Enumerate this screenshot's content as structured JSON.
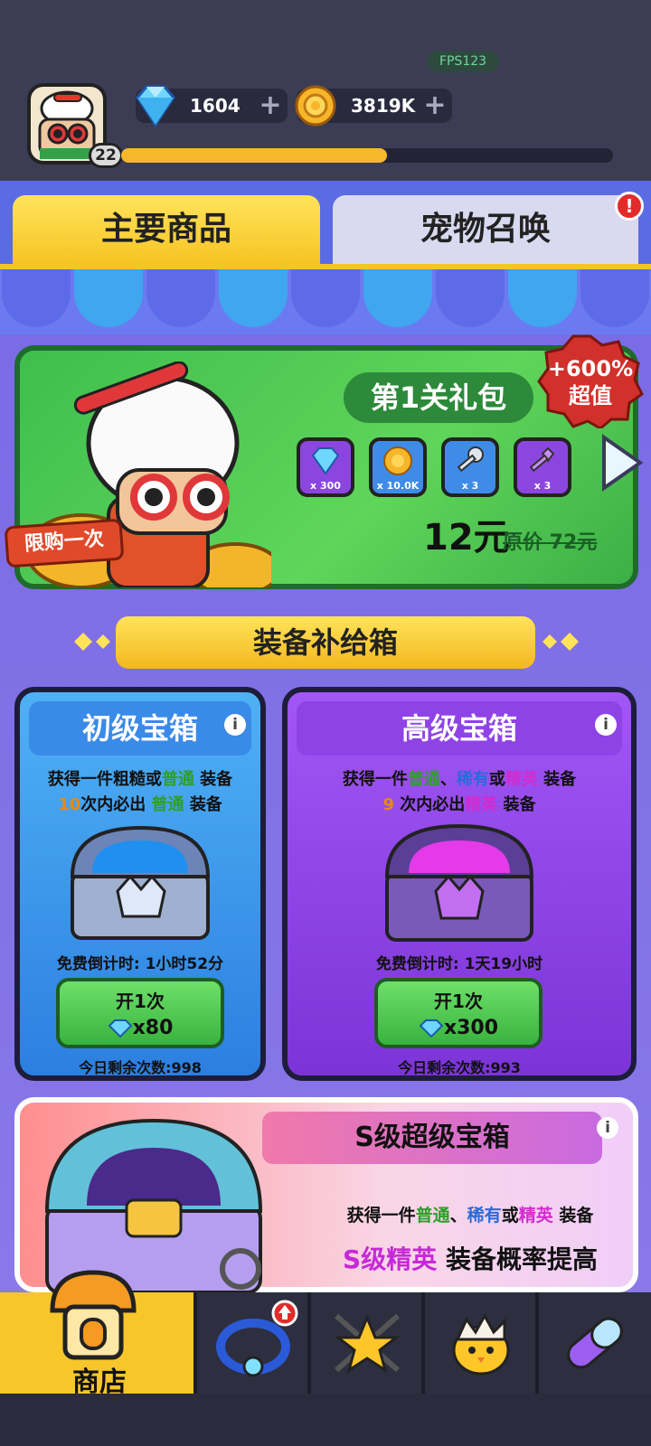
{
  "hud": {
    "fps": "FPS123",
    "level": "22",
    "gems": "1604",
    "gold": "3819K",
    "xp_progress": 0.54
  },
  "tabs": [
    {
      "label": "主要商品",
      "active": true
    },
    {
      "label": "宠物召唤",
      "active": false,
      "alert": "!"
    }
  ],
  "gift_pack": {
    "title": "第1关礼包",
    "limited": "限购一次",
    "badge_line1": "+600%",
    "badge_line2": "超值",
    "items": [
      {
        "icon": "gem-icon",
        "qty": "x 300"
      },
      {
        "icon": "gold-coin-icon",
        "qty": "x 10.0K"
      },
      {
        "icon": "silver-key-icon",
        "qty": "x 3"
      },
      {
        "icon": "purple-key-icon",
        "qty": "x 3"
      }
    ],
    "price": "12元",
    "original_price": "原价 72元"
  },
  "section_title": "装备补给箱",
  "chests": {
    "basic": {
      "title": "初级宝箱",
      "desc1_a": "获得一件粗糙或",
      "desc1_b": "普通",
      "desc1_c": "装备",
      "desc2_a": "10",
      "desc2_b": "次内必出",
      "desc2_c": "普通",
      "desc2_d": "装备",
      "timer": "免费倒计时: 1小时52分",
      "open_label": "开1次",
      "cost": "x80",
      "remaining": "今日剩余次数:998"
    },
    "advanced": {
      "title": "高级宝箱",
      "desc1_a": "获得一件",
      "desc1_b": "普通",
      "desc1_c": "、",
      "desc1_d": "稀有",
      "desc1_e": "或",
      "desc1_f": "精英",
      "desc1_g": "装备",
      "desc2_a": "9",
      "desc2_b": "次内必出",
      "desc2_c": "精英",
      "desc2_d": "装备",
      "timer": "免费倒计时: 1天19小时",
      "open_label": "开1次",
      "cost": "x300",
      "remaining": "今日剩余次数:993"
    },
    "super": {
      "title": "S级超级宝箱",
      "desc1_a": "获得一件",
      "desc1_b": "普通",
      "desc1_c": "、",
      "desc1_d": "稀有",
      "desc1_e": "或",
      "desc1_f": "精英",
      "desc1_g": "装备",
      "desc2_a": "S级精英",
      "desc2_b": "装备概率提高"
    }
  },
  "nav": [
    {
      "label": "商店",
      "icon": "shop-icon",
      "active": true
    },
    {
      "icon": "ring-icon",
      "badge": "upgrade-arrow-icon"
    },
    {
      "icon": "star-swords-icon"
    },
    {
      "icon": "hatching-chick-icon"
    },
    {
      "icon": "capsule-icon"
    }
  ],
  "colors": {
    "accent_yellow": "#f7c62b",
    "basic_blue": "#2c7fe0",
    "advanced_purple": "#7c34d8",
    "green_button": "#38b33e"
  }
}
